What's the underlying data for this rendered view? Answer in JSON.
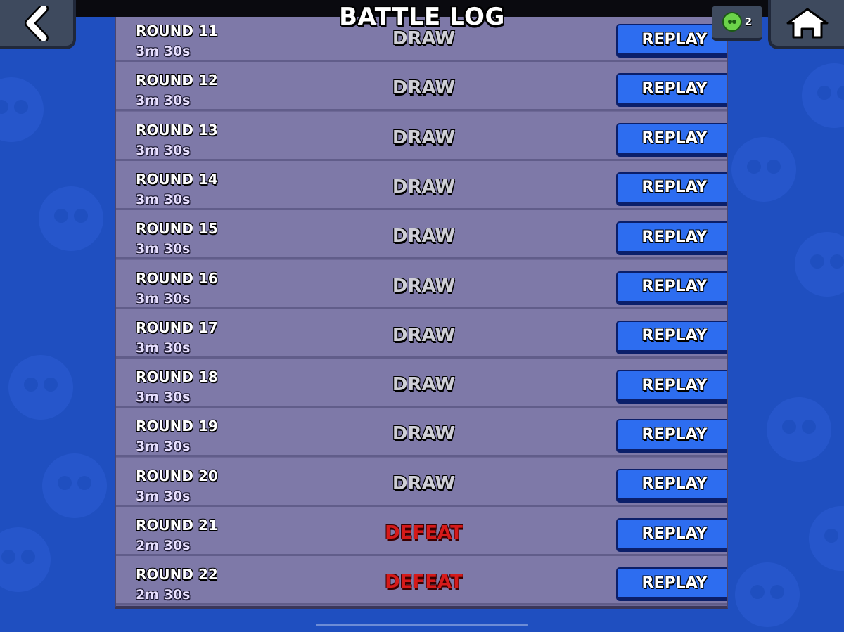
{
  "header": {
    "title": "BATTLE LOG",
    "token_count": "2"
  },
  "colors": {
    "background": "#1f4fc0",
    "panel": "#6d6896",
    "row": "#7e79a8",
    "replay_button": "#2d6df0",
    "draw_text": "#cfcfd6",
    "defeat_text": "#d61a1a"
  },
  "icons": {
    "back": "chevron-left-icon",
    "home": "home-icon",
    "token": "green-skull-token-icon"
  },
  "battles": [
    {
      "round": "ROUND 11",
      "duration": "3m 30s",
      "result": "DRAW",
      "replay_label": "REPLAY"
    },
    {
      "round": "ROUND 12",
      "duration": "3m 30s",
      "result": "DRAW",
      "replay_label": "REPLAY"
    },
    {
      "round": "ROUND 13",
      "duration": "3m 30s",
      "result": "DRAW",
      "replay_label": "REPLAY"
    },
    {
      "round": "ROUND 14",
      "duration": "3m 30s",
      "result": "DRAW",
      "replay_label": "REPLAY"
    },
    {
      "round": "ROUND 15",
      "duration": "3m 30s",
      "result": "DRAW",
      "replay_label": "REPLAY"
    },
    {
      "round": "ROUND 16",
      "duration": "3m 30s",
      "result": "DRAW",
      "replay_label": "REPLAY"
    },
    {
      "round": "ROUND 17",
      "duration": "3m 30s",
      "result": "DRAW",
      "replay_label": "REPLAY"
    },
    {
      "round": "ROUND 18",
      "duration": "3m 30s",
      "result": "DRAW",
      "replay_label": "REPLAY"
    },
    {
      "round": "ROUND 19",
      "duration": "3m 30s",
      "result": "DRAW",
      "replay_label": "REPLAY"
    },
    {
      "round": "ROUND 20",
      "duration": "3m 30s",
      "result": "DRAW",
      "replay_label": "REPLAY"
    },
    {
      "round": "ROUND 21",
      "duration": "2m 30s",
      "result": "DEFEAT",
      "replay_label": "REPLAY"
    },
    {
      "round": "ROUND 22",
      "duration": "2m 30s",
      "result": "DEFEAT",
      "replay_label": "REPLAY"
    }
  ]
}
